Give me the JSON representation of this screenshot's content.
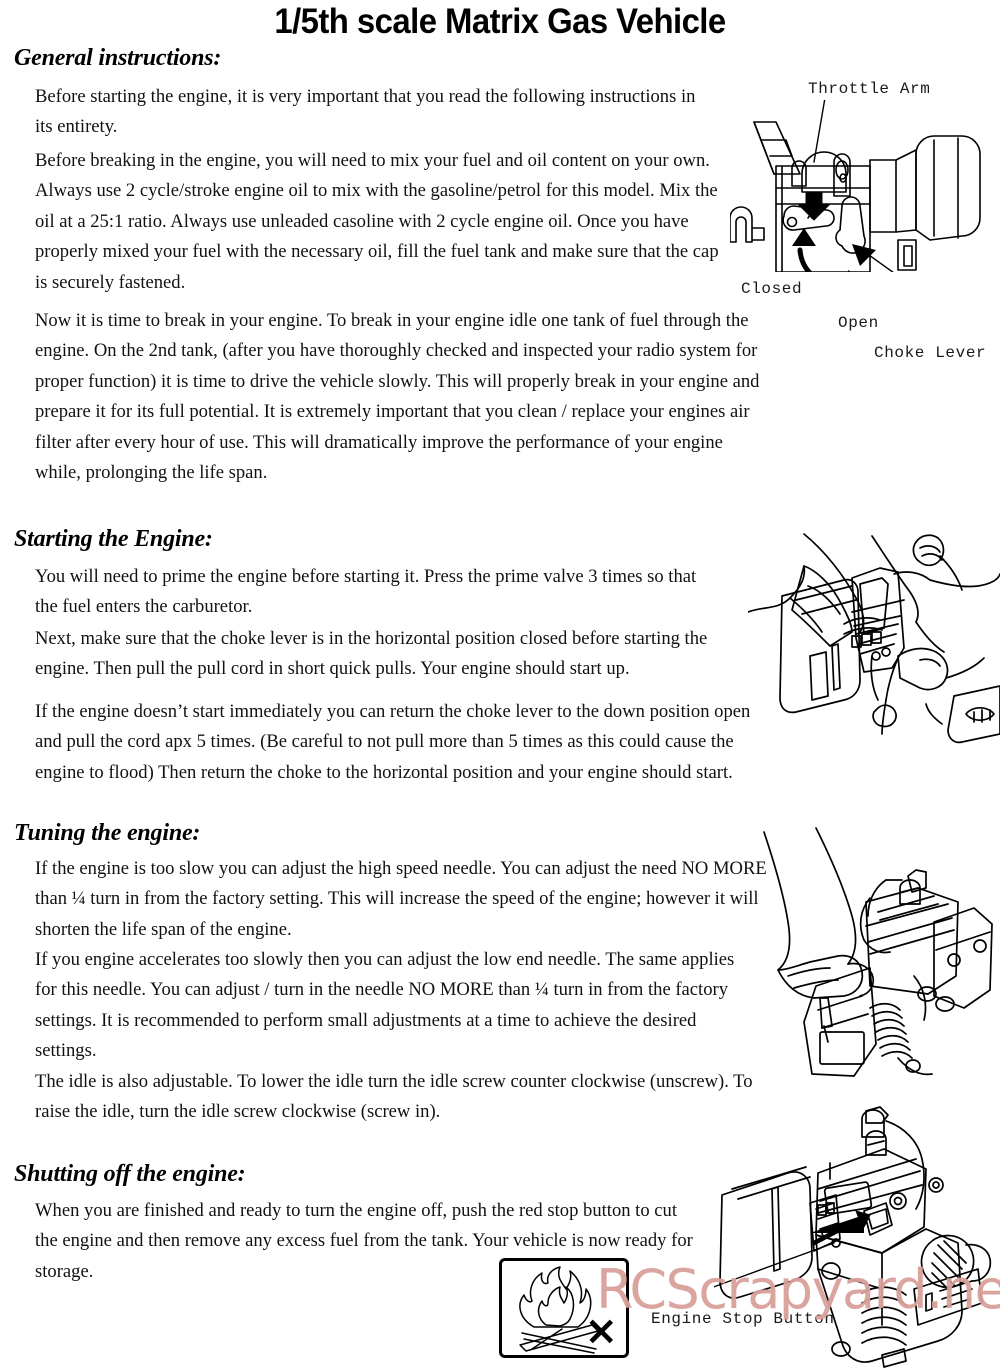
{
  "document": {
    "title": "1/5th scale Matrix Gas Vehicle",
    "watermark": "RCScrapyard.net"
  },
  "sections": {
    "general": {
      "heading": "General instructions:",
      "paragraphs": [
        "Before starting the engine, it is very important that you read the following instructions in its entirety.",
        "Before breaking in the engine, you will need to mix your fuel and oil content on your own.  Always use 2 cycle/stroke engine oil to mix with the gasoline/petrol for this model.  Mix the oil at a 25:1 ratio.  Always use unleaded casoline with 2 cycle engine oil.   Once you have properly mixed your fuel with the necessary oil, fill the fuel tank and make sure that the cap is securely fastened.",
        "Now it is time to break in your engine.  To break in your engine idle one tank of fuel through the engine.  On the 2nd tank, (after you have thoroughly checked and inspected your radio system for proper function) it is time to drive the vehicle slowly.  This will properly break in your engine and prepare it for its full potential.  It is extremely important that you clean / replace your engines air filter after every hour of use.  This will dramatically improve the performance of your engine while, prolonging the life span."
      ]
    },
    "starting": {
      "heading": "Starting the Engine:",
      "paragraphs": [
        "You will need to prime the engine before starting it.  Press the prime valve 3 times so that the fuel enters the carburetor.",
        "Next, make sure that the choke lever is in the horizontal position closed before starting the engine.  Then pull the pull cord in short quick pulls.  Your engine should start up.",
        "If the engine doesn’t start immediately you can return the choke lever to the down position open and pull the cord apx 5 times.  (Be careful to not pull more than 5 times as this could cause the engine to flood)  Then return the choke to the horizontal position and your engine should start."
      ]
    },
    "tuning": {
      "heading": "Tuning the engine:",
      "paragraphs": [
        "If the engine is too slow you can adjust the high speed needle.  You can adjust the need NO MORE than ¼ turn in from the factory setting.  This will increase the speed of the engine; however it will shorten the life span of the engine.",
        "If you engine accelerates too slowly then you can adjust the low end needle.  The same applies for this needle.  You can adjust / turn in the needle NO MORE than ¼ turn in from the factory settings.  It is recommended to perform small adjustments at a time to achieve the desired settings.",
        "The idle is also adjustable.  To lower the idle turn the idle screw counter clockwise (unscrew).  To raise the idle, turn the idle screw clockwise (screw in)."
      ]
    },
    "shutting": {
      "heading": "Shutting off the engine:",
      "paragraphs": [
        "When you are finished and ready to turn the engine off, push the red stop button to cut the engine and then remove any excess fuel from the tank.  Your vehicle is now ready for storage."
      ]
    }
  },
  "figures": {
    "carburetor": {
      "name": "carburetor-choke-diagram",
      "labels": {
        "throttle_arm": "Throttle Arm",
        "closed": "Closed",
        "open": "Open",
        "choke_lever": "Choke Lever"
      }
    },
    "pull_start": {
      "name": "pull-start-illustration"
    },
    "needle_adjust": {
      "name": "needle-adjustment-illustration"
    },
    "engine_stop": {
      "name": "engine-stop-button-illustration",
      "labels": {
        "engine_stop_button": "Engine Stop Button"
      }
    },
    "no_fire_warning": {
      "name": "no-open-flame-warning",
      "mark": "×"
    }
  },
  "colors": {
    "ink": "#000000",
    "watermark": "#d9a09a"
  }
}
